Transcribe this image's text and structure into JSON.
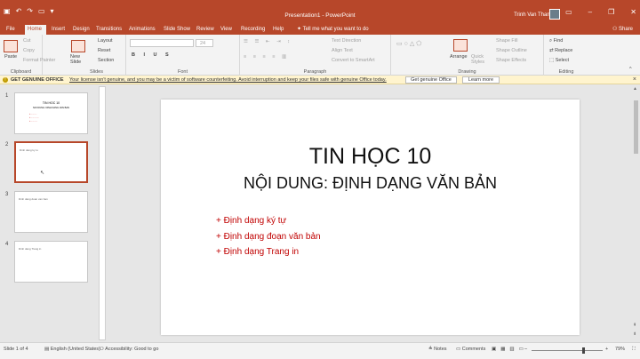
{
  "titlebar": {
    "document_title": "Presentation1 - PowerPoint",
    "user_name": "Trinh Van Thanh",
    "bg_color": "#b7472a"
  },
  "tabs": [
    {
      "label": "File"
    },
    {
      "label": "Home"
    },
    {
      "label": "Insert"
    },
    {
      "label": "Design"
    },
    {
      "label": "Transitions"
    },
    {
      "label": "Animations"
    },
    {
      "label": "Slide Show"
    },
    {
      "label": "Review"
    },
    {
      "label": "View"
    },
    {
      "label": "Recording"
    },
    {
      "label": "Help"
    }
  ],
  "tell_me": "Tell me what you want to do",
  "share": "Share",
  "ribbon": {
    "clipboard": {
      "paste": "Paste",
      "cut": "Cut",
      "copy": "Copy",
      "format_painter": "Format Painter",
      "label": "Clipboard"
    },
    "slides": {
      "new_slide": "New Slide",
      "layout": "Layout",
      "reset": "Reset",
      "section": "Section",
      "label": "Slides"
    },
    "font": {
      "size": "24",
      "label": "Font"
    },
    "paragraph": {
      "text_direction": "Text Direction",
      "align_text": "Align Text",
      "smartart": "Convert to SmartArt",
      "label": "Paragraph"
    },
    "drawing": {
      "arrange": "Arrange",
      "quick_styles": "Quick Styles",
      "shape_fill": "Shape Fill",
      "shape_outline": "Shape Outline",
      "shape_effects": "Shape Effects",
      "label": "Drawing"
    },
    "editing": {
      "find": "Find",
      "replace": "Replace",
      "select": "Select",
      "label": "Editing"
    }
  },
  "infobar": {
    "heading": "GET GENUINE OFFICE",
    "message": "Your license isn't genuine, and you may be a victim of software counterfeiting. Avoid interruption and keep your files safe with genuine Office today.",
    "button_get": "Get genuine Office",
    "button_learn": "Learn more"
  },
  "thumbnails": [
    {
      "number": "1",
      "title": "TIN HOC 10",
      "subtitle": "NOI DUNG: DINH DANG VAN BAN",
      "small_text": ""
    },
    {
      "number": "2",
      "title": "",
      "subtitle": "",
      "small_text": "Dinh dang ky tu"
    },
    {
      "number": "3",
      "title": "",
      "subtitle": "",
      "small_text": "Dinh dang doan van ban"
    },
    {
      "number": "4",
      "title": "",
      "subtitle": "",
      "small_text": "Dinh dang Trang in"
    }
  ],
  "slide": {
    "title": "TIN HỌC 10",
    "subtitle": "NỘI DUNG: ĐỊNH DẠNG VĂN BẢN",
    "bullets": [
      "+ Định dạng ký tự",
      "+ Định dạng đoạn văn bản",
      "+ Định dạng Trang in"
    ],
    "bullet_color": "#c00000"
  },
  "statusbar": {
    "slide_info": "Slide 1 of 4",
    "language": "English (United States)",
    "accessibility": "Accessibility: Good to go",
    "notes": "Notes",
    "comments": "Comments",
    "zoom": "79%"
  }
}
